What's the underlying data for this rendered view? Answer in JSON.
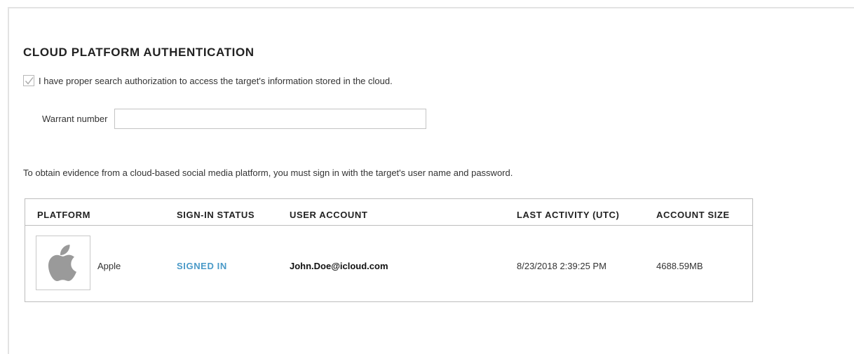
{
  "section": {
    "title": "CLOUD PLATFORM AUTHENTICATION",
    "authorization_text": "I have proper search authorization to access the target's information stored in the cloud.",
    "authorization_checked": true,
    "warrant_label": "Warrant number",
    "warrant_value": "",
    "info_text": "To obtain evidence from a cloud-based social media platform, you must sign in with the target's user name and password."
  },
  "table": {
    "headers": {
      "platform": "PLATFORM",
      "status": "SIGN-IN STATUS",
      "account": "USER ACCOUNT",
      "activity": "LAST ACTIVITY (UTC)",
      "size": "ACCOUNT SIZE"
    },
    "rows": [
      {
        "icon": "apple-logo-icon",
        "platform": "Apple",
        "status": "SIGNED IN",
        "account": "John.Doe@icloud.com",
        "activity": "8/23/2018 2:39:25 PM",
        "size": "4688.59MB"
      }
    ]
  },
  "colors": {
    "status_signed_in": "#4a9ac8",
    "checkmark": "#a9a9a9",
    "apple_logo": "#9a9a9a"
  }
}
